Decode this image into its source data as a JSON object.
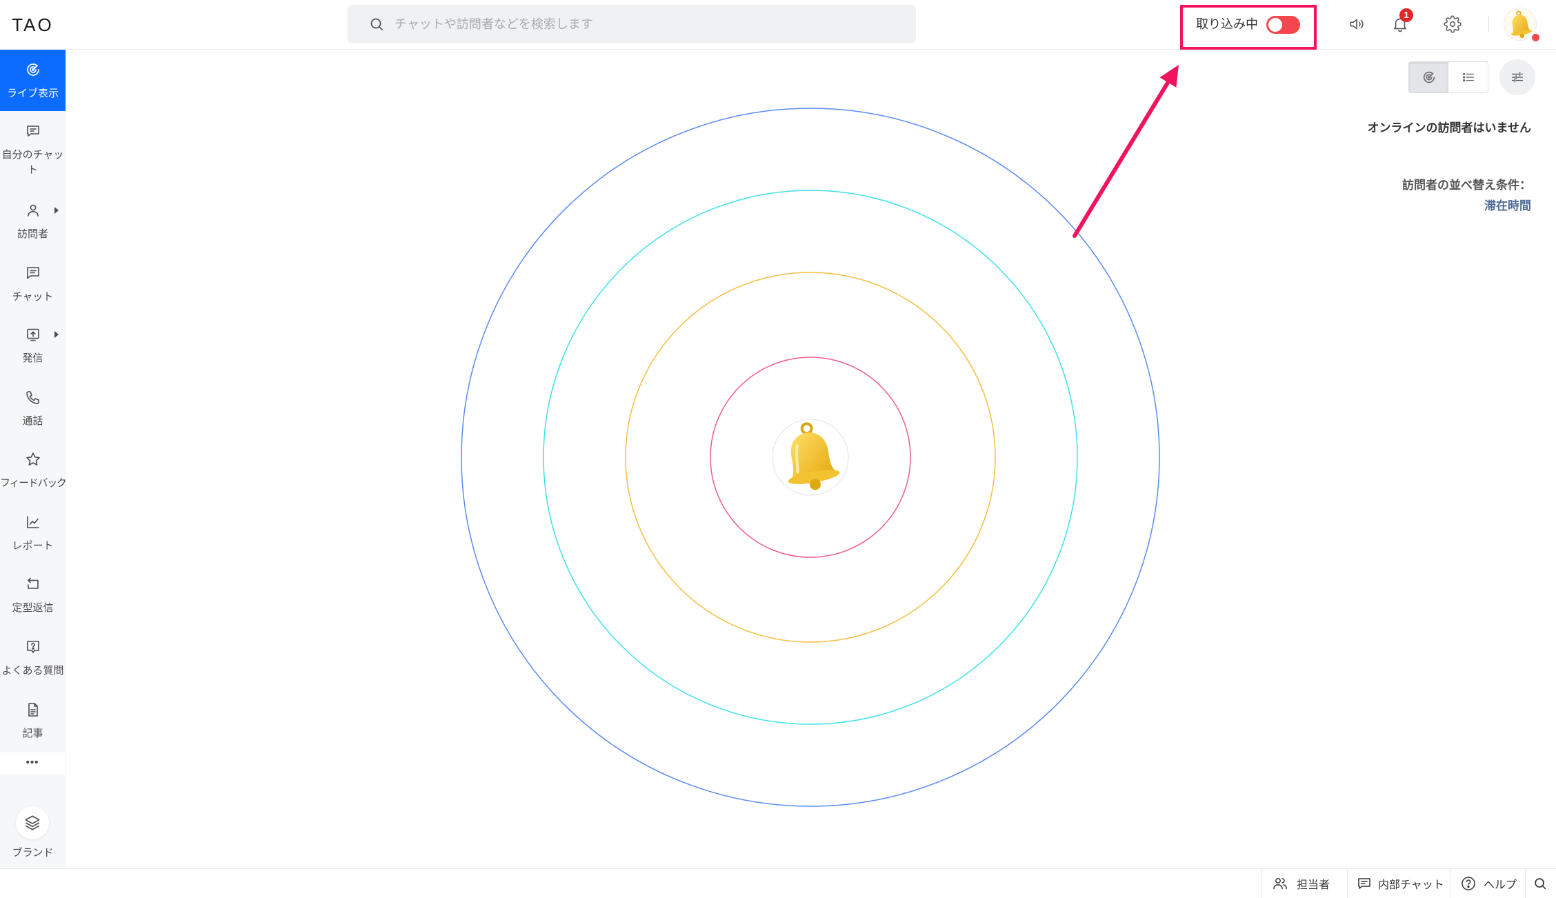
{
  "app": {
    "logo": "TAO"
  },
  "header": {
    "search_placeholder": "チャットや訪問者などを検索します",
    "status_label": "取り込み中",
    "status_toggle_color": "#f5454f",
    "notification_count": "1",
    "badge_color": "#e5252c",
    "avatar_status_color": "#f04b4b",
    "icons": [
      "search-icon",
      "speaker-icon",
      "bell-icon",
      "gear-icon",
      "avatar-bell-icon"
    ]
  },
  "sidebar": {
    "active_color": "#0b6cff",
    "items": [
      {
        "label": "ライブ表示",
        "icon": "radar-icon",
        "active": true
      },
      {
        "label": "自分のチャット",
        "icon": "chat-bubble-icon"
      },
      {
        "label": "訪問者",
        "icon": "person-icon",
        "has_submenu": true
      },
      {
        "label": "チャット",
        "icon": "message-square-icon"
      },
      {
        "label": "発信",
        "icon": "upload-box-icon",
        "has_submenu": true
      },
      {
        "label": "通話",
        "icon": "phone-icon"
      },
      {
        "label": "フィードバック",
        "icon": "star-icon"
      },
      {
        "label": "レポート",
        "icon": "line-chart-icon"
      },
      {
        "label": "定型返信",
        "icon": "reply-box-icon"
      },
      {
        "label": "よくある質問",
        "icon": "question-bubble-icon"
      },
      {
        "label": "記事",
        "icon": "document-icon"
      }
    ],
    "more_label": "•••",
    "brand_label": "ブランド",
    "brand_icon": "layers-icon"
  },
  "main": {
    "view_mode_icons": [
      "radar-icon",
      "list-icon"
    ],
    "filter_icon": "sliders-icon",
    "empty_message": "オンラインの訪問者はいません",
    "sort_label": "訪問者の並べ替え条件：",
    "sort_value": "滞在時間",
    "sort_value_color": "#4f6b95",
    "radar_ring_colors": [
      "#ee5a8c",
      "#f5bd3f",
      "#3fe0ee",
      "#5b8bf2"
    ],
    "radar_center_icon": "bell-icon"
  },
  "footer": {
    "items": [
      {
        "label": "担当者",
        "icon": "people-icon"
      },
      {
        "label": "内部チャット",
        "icon": "chat-icon"
      },
      {
        "label": "ヘルプ",
        "icon": "help-circle-icon"
      }
    ],
    "search_icon": "search-icon"
  },
  "annotation": {
    "color": "#f0145f"
  }
}
